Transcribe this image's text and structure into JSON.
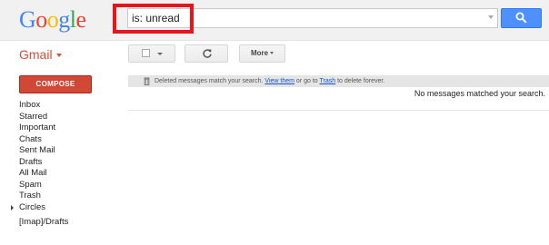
{
  "header": {
    "logo": {
      "letters": [
        {
          "char": "G",
          "color": "#4285f4"
        },
        {
          "char": "o",
          "color": "#ea4335"
        },
        {
          "char": "o",
          "color": "#fbbc05"
        },
        {
          "char": "g",
          "color": "#4285f4"
        },
        {
          "char": "l",
          "color": "#34a853"
        },
        {
          "char": "e",
          "color": "#ea4335"
        }
      ]
    },
    "search": {
      "value": "is: unread",
      "placeholder": ""
    },
    "search_button_icon": "search-icon",
    "highlight_color": "#e8141b"
  },
  "app": {
    "label": "Gmail",
    "accent": "#dd4b39"
  },
  "toolbar": {
    "select_icon": "checkbox-icon",
    "refresh_icon": "refresh-icon",
    "more_label": "More"
  },
  "sidebar": {
    "compose_label": "COMPOSE",
    "compose_color": "#d14836",
    "items": [
      {
        "label": "Inbox"
      },
      {
        "label": "Starred"
      },
      {
        "label": "Important"
      },
      {
        "label": "Chats"
      },
      {
        "label": "Sent Mail"
      },
      {
        "label": "Drafts"
      },
      {
        "label": "All Mail"
      },
      {
        "label": "Spam"
      },
      {
        "label": "Trash"
      },
      {
        "label": "Circles"
      },
      {
        "label": "[Imap]/Drafts"
      }
    ]
  },
  "notice": {
    "prefix": "Deleted messages match your search.",
    "view_link": "View them",
    "middle": "or go to",
    "trash_link": "Trash",
    "suffix": "to delete forever."
  },
  "messages": {
    "empty_text": "No messages matched your search."
  }
}
